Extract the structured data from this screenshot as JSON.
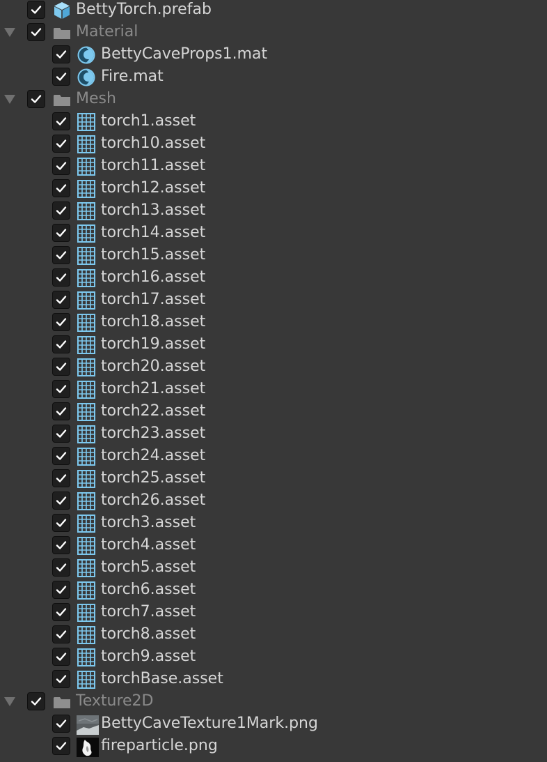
{
  "rows": [
    {
      "level": 0,
      "type": "prefab",
      "label": "BettyTorch.prefab",
      "checked": true
    },
    {
      "level": 0,
      "type": "folder",
      "label": "Material",
      "checked": true,
      "expanded": true
    },
    {
      "level": 1,
      "type": "material",
      "label": "BettyCaveProps1.mat",
      "checked": true
    },
    {
      "level": 1,
      "type": "material",
      "label": "Fire.mat",
      "checked": true
    },
    {
      "level": 0,
      "type": "folder",
      "label": "Mesh",
      "checked": true,
      "expanded": true
    },
    {
      "level": 1,
      "type": "mesh",
      "label": "torch1.asset",
      "checked": true
    },
    {
      "level": 1,
      "type": "mesh",
      "label": "torch10.asset",
      "checked": true
    },
    {
      "level": 1,
      "type": "mesh",
      "label": "torch11.asset",
      "checked": true
    },
    {
      "level": 1,
      "type": "mesh",
      "label": "torch12.asset",
      "checked": true
    },
    {
      "level": 1,
      "type": "mesh",
      "label": "torch13.asset",
      "checked": true
    },
    {
      "level": 1,
      "type": "mesh",
      "label": "torch14.asset",
      "checked": true
    },
    {
      "level": 1,
      "type": "mesh",
      "label": "torch15.asset",
      "checked": true
    },
    {
      "level": 1,
      "type": "mesh",
      "label": "torch16.asset",
      "checked": true
    },
    {
      "level": 1,
      "type": "mesh",
      "label": "torch17.asset",
      "checked": true
    },
    {
      "level": 1,
      "type": "mesh",
      "label": "torch18.asset",
      "checked": true
    },
    {
      "level": 1,
      "type": "mesh",
      "label": "torch19.asset",
      "checked": true
    },
    {
      "level": 1,
      "type": "mesh",
      "label": "torch20.asset",
      "checked": true
    },
    {
      "level": 1,
      "type": "mesh",
      "label": "torch21.asset",
      "checked": true
    },
    {
      "level": 1,
      "type": "mesh",
      "label": "torch22.asset",
      "checked": true
    },
    {
      "level": 1,
      "type": "mesh",
      "label": "torch23.asset",
      "checked": true
    },
    {
      "level": 1,
      "type": "mesh",
      "label": "torch24.asset",
      "checked": true
    },
    {
      "level": 1,
      "type": "mesh",
      "label": "torch25.asset",
      "checked": true
    },
    {
      "level": 1,
      "type": "mesh",
      "label": "torch26.asset",
      "checked": true
    },
    {
      "level": 1,
      "type": "mesh",
      "label": "torch3.asset",
      "checked": true
    },
    {
      "level": 1,
      "type": "mesh",
      "label": "torch4.asset",
      "checked": true
    },
    {
      "level": 1,
      "type": "mesh",
      "label": "torch5.asset",
      "checked": true
    },
    {
      "level": 1,
      "type": "mesh",
      "label": "torch6.asset",
      "checked": true
    },
    {
      "level": 1,
      "type": "mesh",
      "label": "torch7.asset",
      "checked": true
    },
    {
      "level": 1,
      "type": "mesh",
      "label": "torch8.asset",
      "checked": true
    },
    {
      "level": 1,
      "type": "mesh",
      "label": "torch9.asset",
      "checked": true
    },
    {
      "level": 1,
      "type": "mesh",
      "label": "torchBase.asset",
      "checked": true
    },
    {
      "level": 0,
      "type": "folder",
      "label": "Texture2D",
      "checked": true,
      "expanded": true
    },
    {
      "level": 1,
      "type": "texture-stone",
      "label": "BettyCaveTexture1Mark.png",
      "checked": true
    },
    {
      "level": 1,
      "type": "texture-particle",
      "label": "fireparticle.png",
      "checked": true
    }
  ],
  "icons": {
    "prefab": "prefab-cube-icon",
    "folder": "folder-icon",
    "material": "material-sphere-icon",
    "mesh": "mesh-grid-icon",
    "texture-stone": "texture-thumbnail-icon",
    "texture-particle": "texture-thumbnail-icon"
  },
  "colors": {
    "background": "#383838",
    "text": "#d6d6d6",
    "folder_text": "#8a8a8a",
    "accent_icon": "#7dc8ee",
    "checkbox_bg": "#1f1f1f",
    "checkmark": "#ffffff",
    "foldout_arrow": "#707070"
  }
}
